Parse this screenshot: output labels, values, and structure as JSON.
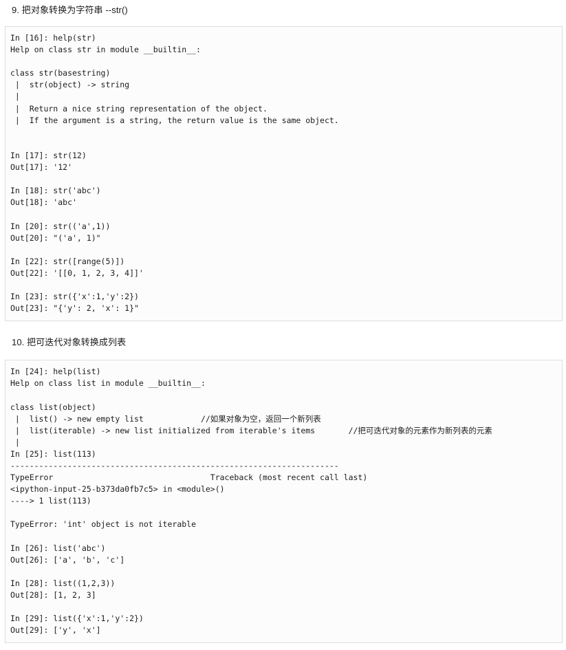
{
  "document": {
    "background_color": "#ffffff",
    "code_block_background": "#fcfcfc",
    "code_block_border": "#dddddd",
    "text_color": "#1c1c1c"
  },
  "sections": [
    {
      "heading": "9. 把对象转换为字符串 --str()",
      "code_lines": [
        "In [16]: help(str)",
        "Help on class str in module __builtin__:",
        "",
        "class str(basestring)",
        " |  str(object) -> string",
        " |",
        " |  Return a nice string representation of the object.",
        " |  If the argument is a string, the return value is the same object.",
        "",
        "",
        "In [17]: str(12)",
        "Out[17]: '12'",
        "",
        "In [18]: str('abc')",
        "Out[18]: 'abc'",
        "",
        "In [20]: str(('a',1))",
        "Out[20]: \"('a', 1)\"",
        "",
        "In [22]: str([range(5)])",
        "Out[22]: '[[0, 1, 2, 3, 4]]'",
        "",
        "In [23]: str({'x':1,'y':2})",
        "Out[23]: \"{'y': 2, 'x': 1}\""
      ]
    },
    {
      "heading": "10. 把可迭代对象转换成列表",
      "code_lines": [
        "In [24]: help(list)",
        "Help on class list in module __builtin__:",
        "",
        "class list(object)",
        " |  list() -> new empty list            //如果对象为空，返回一个新列表",
        " |  list(iterable) -> new list initialized from iterable's items       //把可迭代对象的元素作为新列表的元素",
        " |",
        "In [25]: list(113)",
        "---------------------------------------------------------------------",
        "TypeError                                 Traceback (most recent call last)",
        "<ipython-input-25-b373da0fb7c5> in <module>()",
        "----> 1 list(113)",
        "",
        "TypeError: 'int' object is not iterable",
        "",
        "In [26]: list('abc')",
        "Out[26]: ['a', 'b', 'c']",
        "",
        "In [28]: list((1,2,3))",
        "Out[28]: [1, 2, 3]",
        "",
        "In [29]: list({'x':1,'y':2})",
        "Out[29]: ['y', 'x']"
      ]
    }
  ]
}
